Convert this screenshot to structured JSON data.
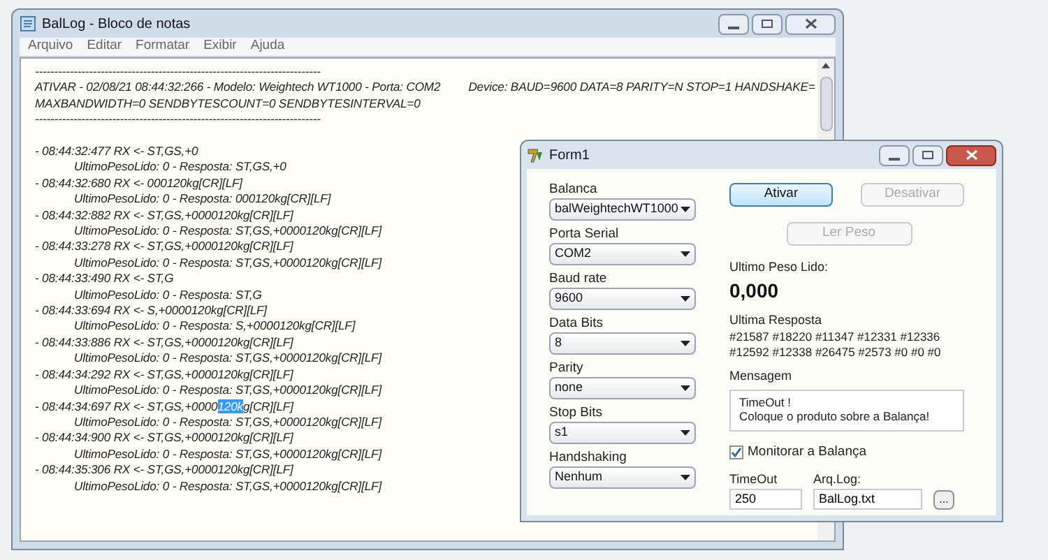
{
  "notepad": {
    "title": "BalLog - Bloco de notas",
    "menu": [
      "Arquivo",
      "Editar",
      "Formatar",
      "Exibir",
      "Ajuda"
    ],
    "lines": [
      {
        "kind": "rule",
        "text": "--------------------------------------------------------------------------"
      },
      {
        "kind": "header",
        "text": "ATIVAR - 02/08/21 08:44:32:266 - Modelo: Weightech WT1000 - Porta: COM2",
        "extra": "Device: BAUD=9600 DATA=8 PARITY=N STOP=1 HANDSHAKE="
      },
      {
        "kind": "header",
        "text": "MAXBANDWIDTH=0 SENDBYTESCOUNT=0 SENDBYTESINTERVAL=0"
      },
      {
        "kind": "rule",
        "text": "--------------------------------------------------------------------------"
      },
      {
        "kind": "blank"
      },
      {
        "kind": "rx",
        "text": "- 08:44:32:477 RX <- ST,GS,+0"
      },
      {
        "kind": "response",
        "text": "UltimoPesoLido: 0 - Resposta: ST,GS,+0"
      },
      {
        "kind": "rx",
        "text": "- 08:44:32:680 RX <- 000120kg[CR][LF]"
      },
      {
        "kind": "response",
        "text": "UltimoPesoLido: 0 - Resposta: 000120kg[CR][LF]"
      },
      {
        "kind": "rx",
        "text": "- 08:44:32:882 RX <- ST,GS,+0000120kg[CR][LF]"
      },
      {
        "kind": "response",
        "text": "UltimoPesoLido: 0 - Resposta: ST,GS,+0000120kg[CR][LF]"
      },
      {
        "kind": "rx",
        "text": "- 08:44:33:278 RX <- ST,GS,+0000120kg[CR][LF]"
      },
      {
        "kind": "response",
        "text": "UltimoPesoLido: 0 - Resposta: ST,GS,+0000120kg[CR][LF]"
      },
      {
        "kind": "rx",
        "text": "- 08:44:33:490 RX <- ST,G"
      },
      {
        "kind": "response",
        "text": "UltimoPesoLido: 0 - Resposta: ST,G"
      },
      {
        "kind": "rx",
        "text": "- 08:44:33:694 RX <- S,+0000120kg[CR][LF]"
      },
      {
        "kind": "response",
        "text": "UltimoPesoLido: 0 - Resposta: S,+0000120kg[CR][LF]"
      },
      {
        "kind": "rx",
        "text": "- 08:44:33:886 RX <- ST,GS,+0000120kg[CR][LF]"
      },
      {
        "kind": "response",
        "text": "UltimoPesoLido: 0 - Resposta: ST,GS,+0000120kg[CR][LF]"
      },
      {
        "kind": "rx",
        "text": "- 08:44:34:292 RX <- ST,GS,+0000120kg[CR][LF]"
      },
      {
        "kind": "response",
        "text": "UltimoPesoLido: 0 - Resposta: ST,GS,+0000120kg[CR][LF]"
      },
      {
        "kind": "rx",
        "segments": [
          {
            "text": "- 08:44:34:697 RX <- ST,GS,+0000",
            "selected": false
          },
          {
            "text": "120k",
            "selected": true
          },
          {
            "text": "g[CR][LF]",
            "selected": false
          }
        ]
      },
      {
        "kind": "response",
        "text": "UltimoPesoLido: 0 - Resposta: ST,GS,+0000120kg[CR][LF]"
      },
      {
        "kind": "rx",
        "text": "- 08:44:34:900 RX <- ST,GS,+0000120kg[CR][LF]"
      },
      {
        "kind": "response",
        "text": "UltimoPesoLido: 0 - Resposta: ST,GS,+0000120kg[CR][LF]"
      },
      {
        "kind": "rx",
        "text": "- 08:44:35:306 RX <- ST,GS,+0000120kg[CR][LF]"
      },
      {
        "kind": "response",
        "text": "UltimoPesoLido: 0 - Resposta: ST,GS,+0000120kg[CR][LF]"
      }
    ]
  },
  "form": {
    "title": "Form1",
    "selects": [
      {
        "label": "Balanca",
        "value": "balWeightechWT1000"
      },
      {
        "label": "Porta Serial",
        "value": "COM2"
      },
      {
        "label": "Baud rate",
        "value": "9600"
      },
      {
        "label": "Data Bits",
        "value": "8"
      },
      {
        "label": "Parity",
        "value": "none"
      },
      {
        "label": "Stop Bits",
        "value": "s1"
      },
      {
        "label": "Handshaking",
        "value": "Nenhum"
      }
    ],
    "buttons": [
      {
        "label": "Ativar",
        "disabled": false
      },
      {
        "label": "Desativar",
        "disabled": true
      }
    ],
    "read_button": {
      "label": "Ler Peso",
      "disabled": true
    },
    "last_weight": {
      "label": "Ultimo Peso Lido:",
      "value": "0,000"
    },
    "last_response": {
      "label": "Ultima Resposta",
      "lines": [
        "#21587 #18220 #11347 #12331 #12336",
        "#12592 #12338 #26475 #2573 #0 #0 #0"
      ]
    },
    "message": {
      "label": "Mensagem",
      "lines": [
        "TimeOut !",
        "Coloque o produto sobre a Balança!"
      ]
    },
    "monitor": {
      "label": "Monitorar a Balança",
      "checked": true
    },
    "timeout": {
      "label": "TimeOut",
      "value": "250"
    },
    "log_file": {
      "label": "Arq.Log:",
      "value": "BalLog.txt",
      "button": "..."
    }
  }
}
